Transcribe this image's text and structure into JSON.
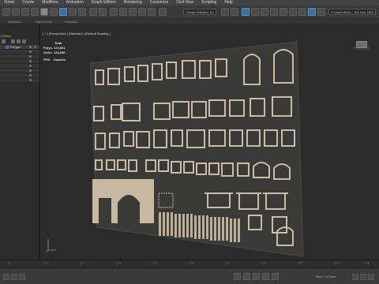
{
  "menubar": {
    "items": [
      "Views",
      "Create",
      "Modifiers",
      "Animation",
      "Graph Editors",
      "Rendering",
      "Customize",
      "Civil View",
      "Scripting",
      "Help"
    ]
  },
  "toolbar": {
    "selection_set": "Create Selection Se",
    "user_field": "C:\\Users\\Devt... 3ds Max 2022"
  },
  "ribbon": {
    "tabs": [
      "Selection",
      "Object Paint",
      "Populate"
    ]
  },
  "scene_explorer": {
    "header": "Entities",
    "layers": [
      {
        "label": "Polygon",
        "selected": true
      },
      {
        "label": "",
        "selected": false
      },
      {
        "label": "",
        "selected": false
      },
      {
        "label": "",
        "selected": false
      },
      {
        "label": "",
        "selected": false
      },
      {
        "label": "",
        "selected": false
      },
      {
        "label": "",
        "selected": false
      },
      {
        "label": "",
        "selected": false
      }
    ]
  },
  "viewport": {
    "label": "[ + ] [Perspective ] [Standard ] [Default Shading ]",
    "stats": {
      "total_label": "Total",
      "polys_label": "Polys:",
      "polys_value": "122,841",
      "verts_label": "Verts:",
      "verts_value": "124,206",
      "fps_label": "FPS:",
      "fps_value": "Inactive"
    }
  },
  "timeline": {
    "tick_labels": [
      "0",
      "10",
      "20",
      "30",
      "40",
      "50",
      "60",
      "70",
      "80",
      "90",
      "100"
    ]
  },
  "statusbar": {
    "coords": "Grid = 10,0cm"
  },
  "colors": {
    "accent": "#3b6f9e",
    "panel_bg": "#2c2c2c",
    "viewport_bg": "#2b2b2b",
    "trim": "#c9b8a4"
  }
}
